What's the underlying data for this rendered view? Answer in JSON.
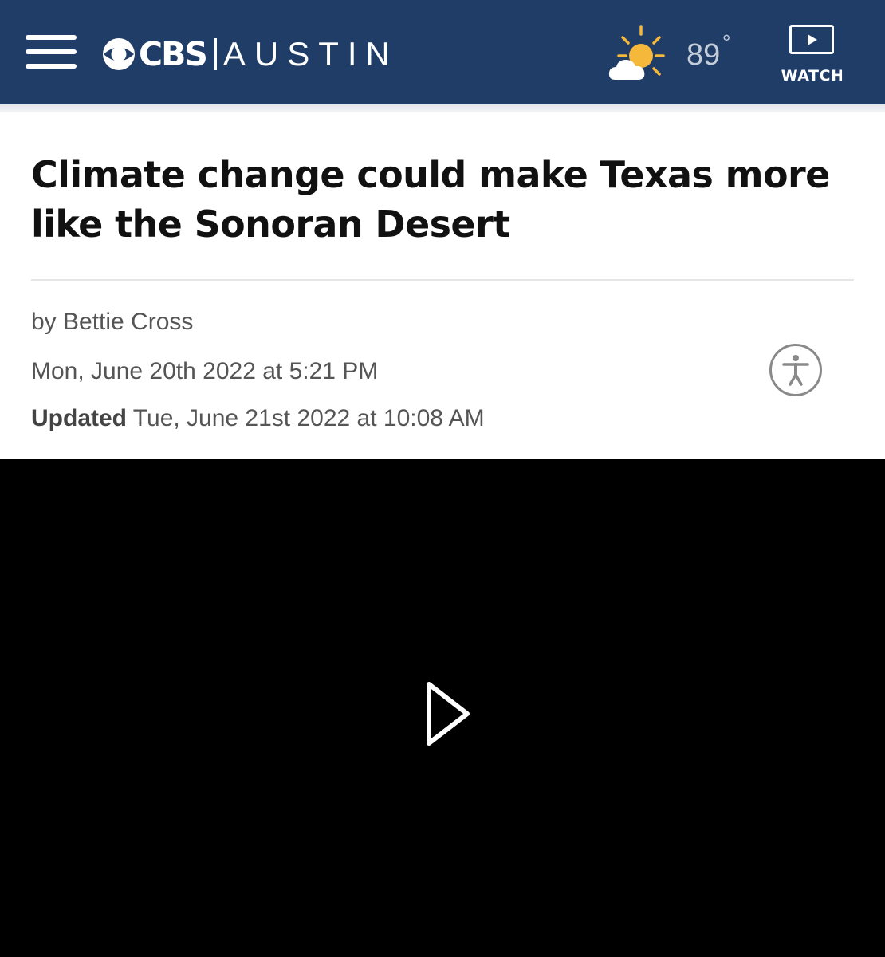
{
  "header": {
    "logo_network": "CBS",
    "logo_city": "AUSTIN",
    "weather": {
      "icon": "partly-sunny-icon",
      "temperature": "89",
      "degree_symbol": "°"
    },
    "watch_label": "WATCH"
  },
  "article": {
    "headline": "Climate change could make Texas more like the Sonoran Desert",
    "byline": "by Bettie Cross",
    "published": "Mon, June 20th 2022 at 5:21 PM",
    "updated_label": "Updated",
    "updated": "Tue, June 21st 2022 at 10:08 AM"
  },
  "colors": {
    "header_bg": "#1f3d67",
    "sun": "#f5b83a",
    "video_bg": "#000000"
  }
}
